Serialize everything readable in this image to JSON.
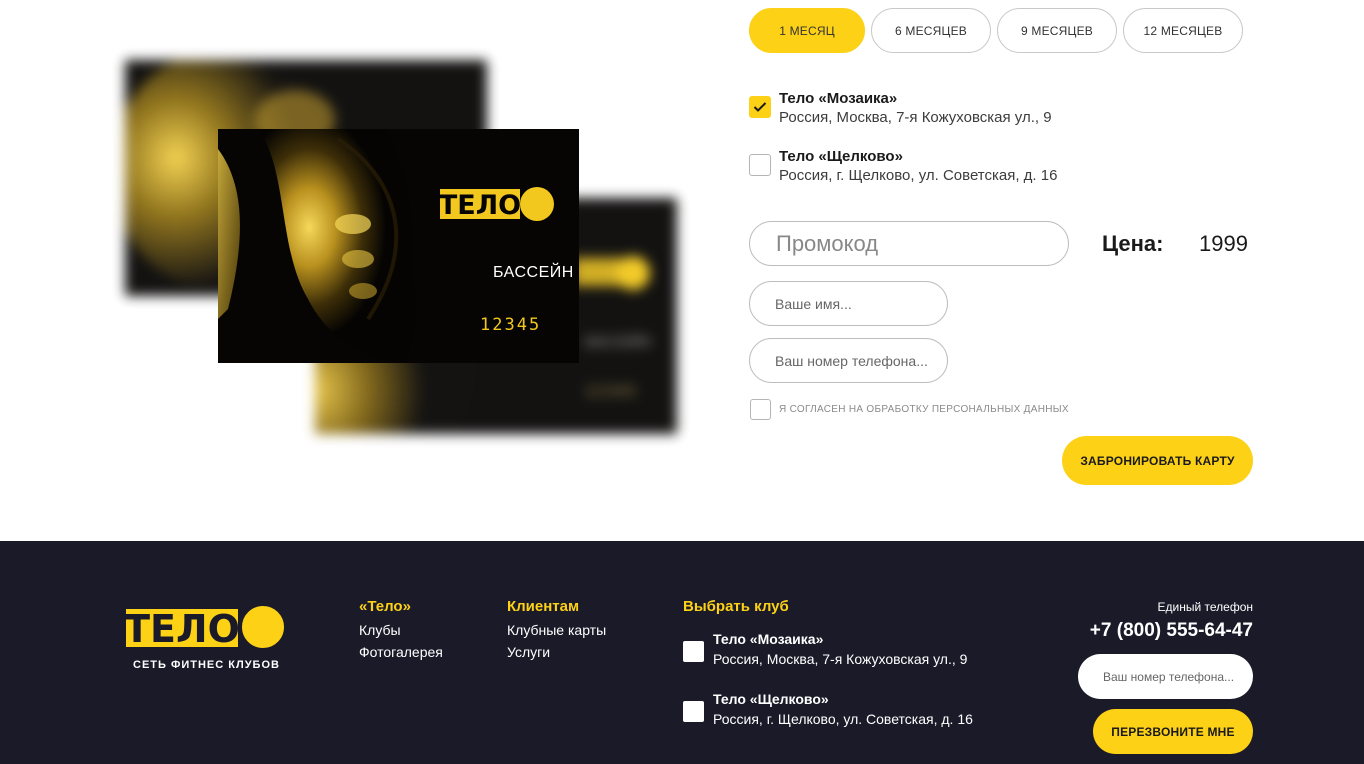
{
  "card": {
    "brand": "ТЕЛО",
    "label": "БАССЕЙН",
    "number": "12345"
  },
  "periods": [
    {
      "label": "1 МЕСЯЦ",
      "active": true
    },
    {
      "label": "6 МЕСЯЦЕВ",
      "active": false
    },
    {
      "label": "9 МЕСЯЦЕВ",
      "active": false
    },
    {
      "label": "12 МЕСЯЦЕВ",
      "active": false
    }
  ],
  "clubs": [
    {
      "name": "Тело «Мозаика»",
      "address": "Россия, Москва, 7-я Кожуховская ул., 9",
      "checked": true
    },
    {
      "name": "Тело «Щелково»",
      "address": "Россия, г. Щелково, ул. Советская, д. 16",
      "checked": false
    }
  ],
  "form": {
    "promo_placeholder": "Промокод",
    "price_label": "Цена:",
    "price_value": "1999",
    "name_placeholder": "Ваше имя...",
    "phone_placeholder": "Ваш номер телефона...",
    "consent_text": "Я СОГЛАСЕН НА ОБРАБОТКУ ПЕРСОНАЛЬНЫХ ДАННЫХ",
    "submit_label": "ЗАБРОНИРОВАТЬ КАРТУ"
  },
  "footer": {
    "logo_text": "ТЕЛО",
    "slogan": "СЕТЬ ФИТНЕС КЛУБОВ",
    "columns": [
      {
        "heading": "«Тело»",
        "links": [
          "Клубы",
          "Фотогалерея"
        ]
      },
      {
        "heading": "Клиентам",
        "links": [
          "Клубные карты",
          "Услуги"
        ]
      }
    ],
    "club_heading": "Выбрать клуб",
    "clubs": [
      {
        "name": "Тело «Мозаика»",
        "address": "Россия, Москва, 7-я Кожуховская ул., 9"
      },
      {
        "name": "Тело «Щелково»",
        "address": "Россия, г. Щелково, ул. Советская, д. 16"
      }
    ],
    "phone_label": "Единый телефон",
    "phone": "+7 (800) 555-64-47",
    "phone_placeholder": "Ваш номер телефона...",
    "callback_label": "ПЕРЕЗВОНИТЕ МНЕ"
  },
  "colors": {
    "accent": "#fcd116",
    "footer_bg": "#1b1a29"
  }
}
